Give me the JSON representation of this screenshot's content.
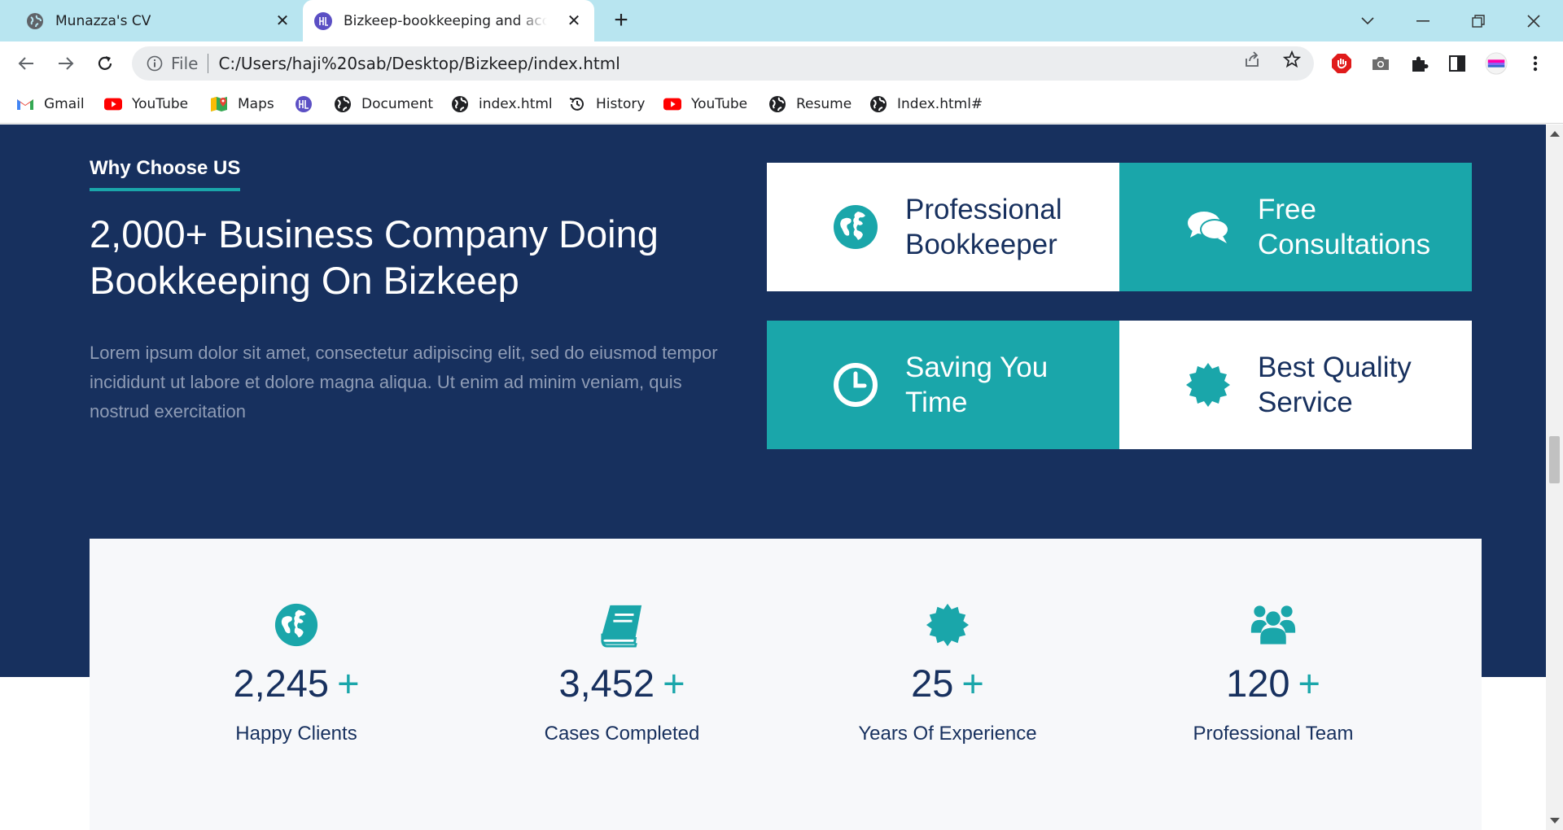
{
  "browser": {
    "tabs": [
      {
        "title": "Munazza's CV",
        "active": false
      },
      {
        "title": "Bizkeep-bookkeeping and accounting",
        "active": true
      }
    ],
    "address": {
      "scheme": "File",
      "url": "C:/Users/haji%20sab/Desktop/Bizkeep/index.html"
    },
    "bookmarks": [
      {
        "label": "Gmail",
        "icon": "gmail-icon"
      },
      {
        "label": "YouTube",
        "icon": "youtube-icon"
      },
      {
        "label": "Maps",
        "icon": "maps-icon"
      },
      {
        "label": "",
        "icon": "site-logo-icon"
      },
      {
        "label": "Document",
        "icon": "globe-icon"
      },
      {
        "label": "index.html",
        "icon": "globe-icon"
      },
      {
        "label": "History",
        "icon": "history-icon"
      },
      {
        "label": "YouTube",
        "icon": "youtube-icon"
      },
      {
        "label": "Resume",
        "icon": "globe-icon"
      },
      {
        "label": "Index.html#",
        "icon": "globe-icon"
      }
    ]
  },
  "page": {
    "colors": {
      "navy": "#17305e",
      "teal": "#1aa6aa",
      "light": "#f7f8fa"
    },
    "why": {
      "eyebrow": "Why Choose US",
      "headline_line1": "2,000+ Business Company Doing",
      "headline_line2": "Bookkeeping On Bizkeep",
      "lede": "Lorem ipsum dolor sit amet, consectetur adipiscing elit, sed do eiusmod tempor incididunt ut labore et dolore magna aliqua. Ut enim ad minim veniam, quis nostrud exercitation"
    },
    "features": [
      {
        "line1": "Professional",
        "line2": "Bookkeeper",
        "icon": "globe-icon",
        "style": "light"
      },
      {
        "line1": "Free",
        "line2": "Consultations",
        "icon": "chat-bubbles-icon",
        "style": "teal"
      },
      {
        "line1": "Saving You",
        "line2": "Time",
        "icon": "clock-icon",
        "style": "teal"
      },
      {
        "line1": "Best Quality",
        "line2": "Service",
        "icon": "badge-icon",
        "style": "light"
      }
    ],
    "stats": [
      {
        "value": "2,245",
        "plus": "+",
        "label": "Happy Clients",
        "icon": "globe-icon"
      },
      {
        "value": "3,452",
        "plus": "+",
        "label": "Cases Completed",
        "icon": "book-icon"
      },
      {
        "value": "25",
        "plus": "+",
        "label": "Years Of Experience",
        "icon": "badge-icon"
      },
      {
        "value": "120",
        "plus": "+",
        "label": "Professional Team",
        "icon": "users-icon"
      }
    ]
  }
}
